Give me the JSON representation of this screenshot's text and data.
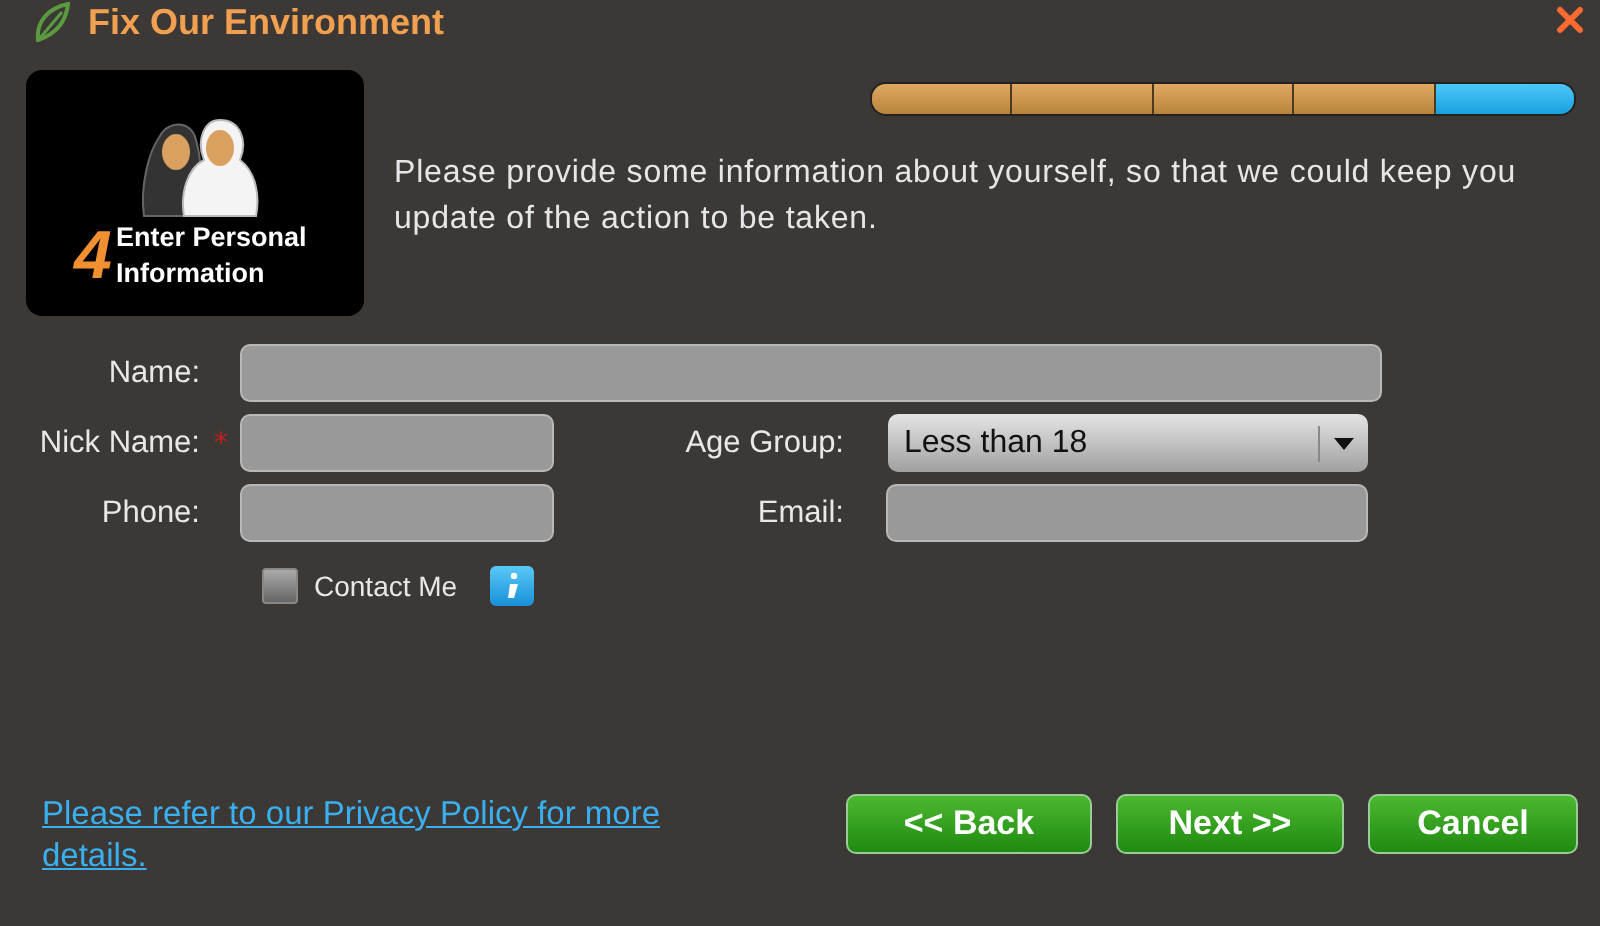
{
  "window": {
    "title": "Fix Our Environment"
  },
  "step": {
    "number": "4",
    "title": "Enter Personal Information"
  },
  "progress": [
    {
      "selected": false
    },
    {
      "selected": false
    },
    {
      "selected": false
    },
    {
      "selected": false
    },
    {
      "selected": true
    }
  ],
  "description": "Please provide some information about yourself, so that we could keep you update of the action to be taken.",
  "name_field": {
    "label": "Name:"
  },
  "fields": [
    {
      "kind": "text",
      "label": "Nick Name:",
      "required_mark": "*"
    },
    {
      "kind": "select",
      "label": "Age Group:",
      "value": "Less than 18"
    },
    {
      "kind": "text",
      "label": "Phone:"
    },
    {
      "kind": "text",
      "label": "Email:"
    }
  ],
  "contact": {
    "label": "Contact Me",
    "checked": false
  },
  "privacy_link": "Please refer to our Privacy Policy for more details.",
  "buttons": [
    "<< Back",
    "Next >>",
    "Cancel"
  ]
}
